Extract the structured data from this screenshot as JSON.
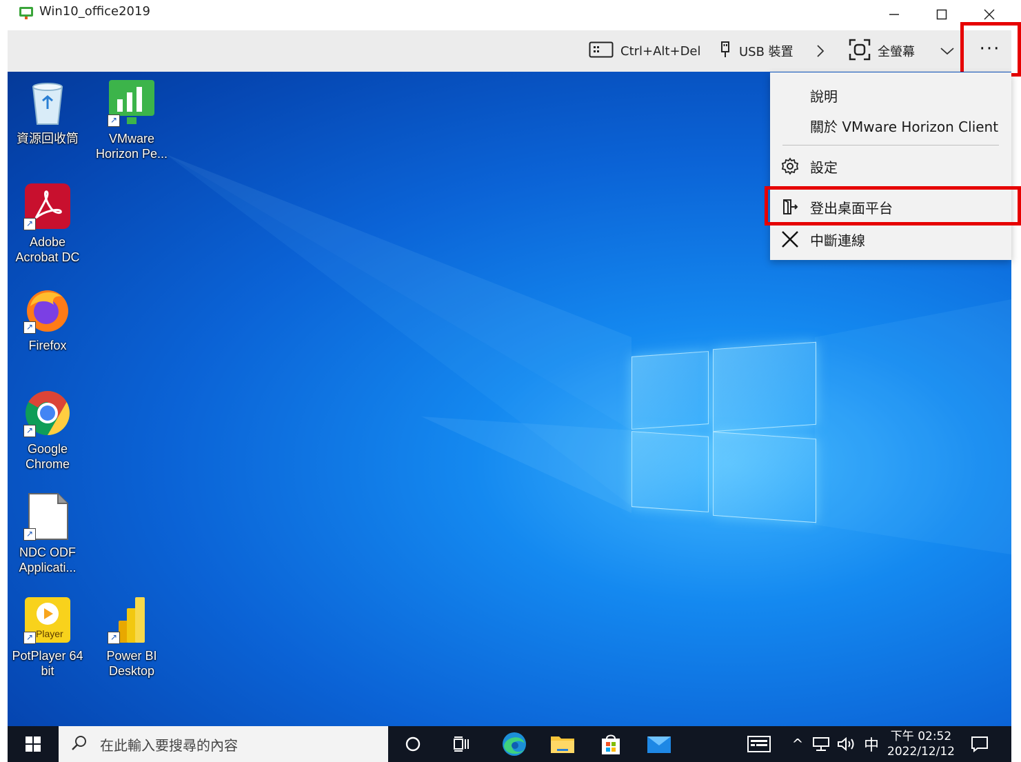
{
  "window": {
    "title": "Win10_office2019",
    "controls": {
      "minimize": "─",
      "maximize": "☐",
      "close": "✕"
    }
  },
  "toolbar": {
    "ctrl_alt_del": "Ctrl+Alt+Del",
    "usb": "USB 裝置",
    "next_arrow": "›",
    "fullscreen": "全螢幕",
    "dropdown": "⌄",
    "more": "···"
  },
  "desktop_icons": [
    {
      "label": "資源回收筒",
      "icon": "recycle-bin-icon"
    },
    {
      "label": "VMware\nHorizon Pe...",
      "icon": "vmware-horizon-performance-icon"
    },
    {
      "label": "Adobe\nAcrobat DC",
      "icon": "adobe-acrobat-icon"
    },
    {
      "label": "Firefox",
      "icon": "firefox-icon"
    },
    {
      "label": "Google\nChrome",
      "icon": "chrome-icon"
    },
    {
      "label": "NDC ODF\nApplicati...",
      "icon": "ndc-odf-icon"
    },
    {
      "label": "PotPlayer 64\nbit",
      "icon": "potplayer-icon"
    },
    {
      "label": "Power BI\nDesktop",
      "icon": "power-bi-icon"
    }
  ],
  "menu": {
    "help": "說明",
    "about": "關於 VMware Horizon Client",
    "settings": "設定",
    "logoff": "登出桌面平台",
    "disconnect": "中斷連線"
  },
  "taskbar": {
    "search_placeholder": "在此輸入要搜尋的內容",
    "ime": "中",
    "tray_chevron": "^",
    "time": "下午 02:52",
    "date": "2022/12/12"
  },
  "colors": {
    "highlight_red": "#e60000",
    "desktop_blue": "#0b63d6",
    "taskbar": "#101622"
  }
}
